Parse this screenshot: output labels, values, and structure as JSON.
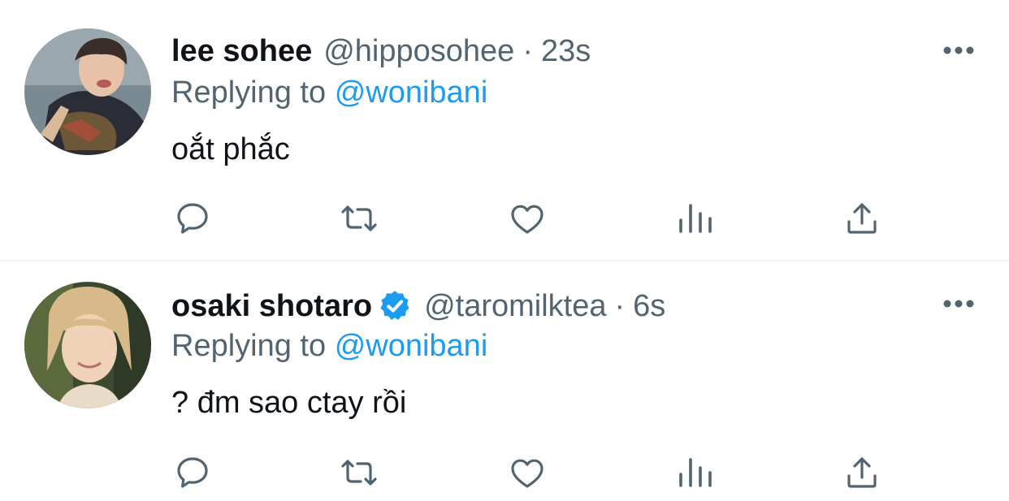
{
  "tweets": [
    {
      "name": "lee sohee",
      "handle": "@hipposohee",
      "separator": "·",
      "time": "23s",
      "verified": false,
      "replying_prefix": "Replying to",
      "replying_to": "@wonibani",
      "text": "oắt phắc"
    },
    {
      "name": "osaki shotaro",
      "handle": "@taromilktea",
      "separator": "·",
      "time": "6s",
      "verified": true,
      "replying_prefix": "Replying to",
      "replying_to": "@wonibani",
      "text": "? đm sao ctay rồi"
    }
  ],
  "actions": [
    "reply-icon",
    "retweet-icon",
    "like-icon",
    "analytics-icon",
    "share-icon"
  ],
  "colors": {
    "text": "#0f1419",
    "secondary": "#536471",
    "accent": "#1d9bf0",
    "divider": "#eff3f4"
  }
}
